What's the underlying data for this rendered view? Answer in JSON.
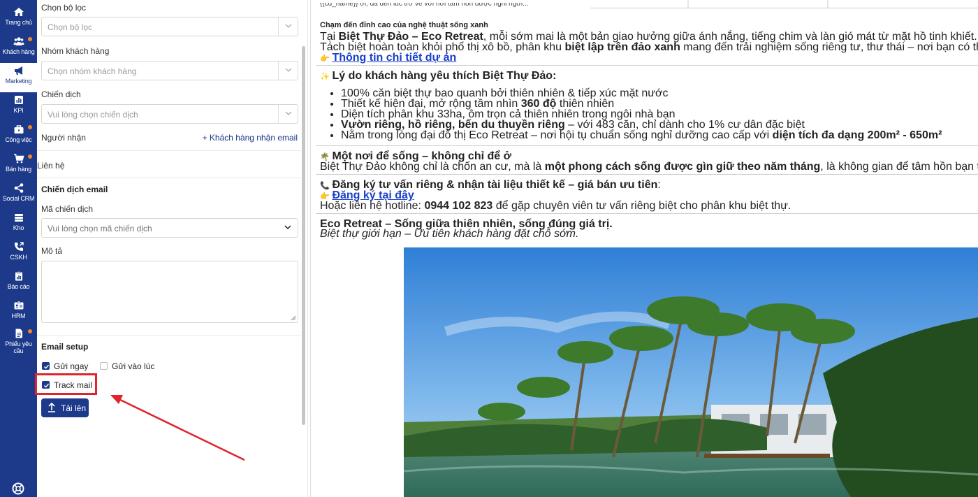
{
  "sidebar": {
    "items": [
      {
        "label": "Trang chủ",
        "icon": "home-icon",
        "dot": false
      },
      {
        "label": "Khách hàng",
        "icon": "users-icon",
        "dot": true
      },
      {
        "label": "Marketing",
        "icon": "megaphone-icon",
        "dot": false,
        "active": true
      },
      {
        "label": "KPI",
        "icon": "chart-icon",
        "dot": false
      },
      {
        "label": "Công việc",
        "icon": "briefcase-icon",
        "dot": true
      },
      {
        "label": "Bán hàng",
        "icon": "cart-icon",
        "dot": true
      },
      {
        "label": "Social CRM",
        "icon": "share-icon",
        "dot": false
      },
      {
        "label": "Kho",
        "icon": "warehouse-icon",
        "dot": false
      },
      {
        "label": "CSKH",
        "icon": "phone-icon",
        "dot": false
      },
      {
        "label": "Báo cáo",
        "icon": "report-icon",
        "dot": false
      },
      {
        "label": "HRM",
        "icon": "id-card-icon",
        "dot": false
      },
      {
        "label": "Phiếu yêu cầu",
        "icon": "document-icon",
        "dot": true
      }
    ]
  },
  "form": {
    "filter_label": "Chọn bộ lọc",
    "filter_placeholder": "Chọn bộ lọc",
    "customer_group_label": "Nhóm khách hàng",
    "customer_group_placeholder": "Chọn nhóm khách hàng",
    "campaign_label": "Chiến dịch",
    "campaign_placeholder": "Vui lòng chọn chiến dịch",
    "recipient_label": "Người nhận",
    "add_recipient_link": "+ Khách hàng nhận email",
    "contact_label": "Liên hệ",
    "email_campaign_section": "Chiến dịch email",
    "campaign_code_label": "Mã chiến dịch",
    "campaign_code_placeholder": "Vui lòng chọn mã chiến dịch",
    "description_label": "Mô tả",
    "email_setup_section": "Email setup",
    "send_now_label": "Gửi ngay",
    "send_now_checked": true,
    "send_at_label": "Gửi vào lúc",
    "send_at_checked": false,
    "track_mail_label": "Track mail",
    "track_mail_checked": true,
    "upload_button": "Tải lên"
  },
  "preview": {
    "top_cut": "{{cd_name}} ơi, đã đến lúc trở về với nơi tâm hồn được nghỉ ngơi...",
    "s1_title": "Chạm đến đỉnh cao của nghệ thuật sống xanh",
    "s1_line1_a": "Tại ",
    "s1_line1_b": "Biệt Thự Đảo – Eco Retreat",
    "s1_line1_c": ", mỗi sớm mai là một bản giao hưởng giữa ánh nắng, tiếng chim và làn gió mát từ mặt hồ tinh khiết.",
    "s1_line2_a": "Tách biệt hoàn toàn khỏi phố thị xô bồ, phân khu ",
    "s1_line2_b": "biệt lập trên đảo xanh",
    "s1_line2_c": " mang đến trải nghiệm sống riêng tư, thư thái – nơi bạn có thể sống trọn từng khoảnh khắc cùng thiên nhiên.",
    "s1_link": "Thông tin chi tiết dự án",
    "s2_title": "Lý do khách hàng yêu thích Biệt Thự Đảo:",
    "s2_b1": "100% căn biệt thự bao quanh bởi thiên nhiên & tiếp xúc mặt nước",
    "s2_b2_a": "Thiết kế hiện đại, mở rộng tầm nhìn ",
    "s2_b2_b": "360 độ",
    "s2_b2_c": " thiên nhiên",
    "s2_b3": "Diện tích phân khu 33ha, ôm trọn cả thiên nhiên trong ngôi nhà bạn",
    "s2_b4_a": "Vườn riêng, hồ riêng, bến du thuyền riêng",
    "s2_b4_b": " – với 483 căn, chỉ dành cho 1% cư dân đặc biệt",
    "s2_b5_a": "Nằm trong lòng đại đô thị Eco Retreat – nơi hội tụ chuẩn sống nghỉ dưỡng cao cấp với ",
    "s2_b5_b": "diện tích đa dạng 200m² - 650m²",
    "s3_title": "Một nơi để sống – không chỉ để ở",
    "s3_line_a": "Biệt Thự Đảo không chỉ là chốn an cư, mà là ",
    "s3_line_b": "một phong cách sống được gìn giữ theo năm tháng",
    "s3_line_c": ", là không gian để tâm hồn bạn trở về cân bằng sau những ngày bận rộn.",
    "s4_title": "Đăng ký tư vấn riêng & nhận tài liệu thiết kế – giá bán ưu tiên",
    "s4_title_tail": ":",
    "s4_link": "Đăng ký tại đây",
    "s4_line_a": "Hoặc liên hệ hotline: ",
    "s4_line_b": "0944 102 823",
    "s4_line_c": " để gặp chuyên viên tư vấn riêng biệt cho phân khu biệt thự.",
    "s5_title": "Eco Retreat – Sống giữa thiên nhiên, sống đúng giá trị.",
    "s5_sub": "Biệt thự giới hạn – Ưu tiên khách hàng đặt chỗ sớm."
  },
  "colors": {
    "sidebar": "#1d3a8a",
    "accent": "#1d3a8a",
    "highlight": "#e0242a",
    "link": "#1a3fc8",
    "badge": "#f08a24"
  }
}
